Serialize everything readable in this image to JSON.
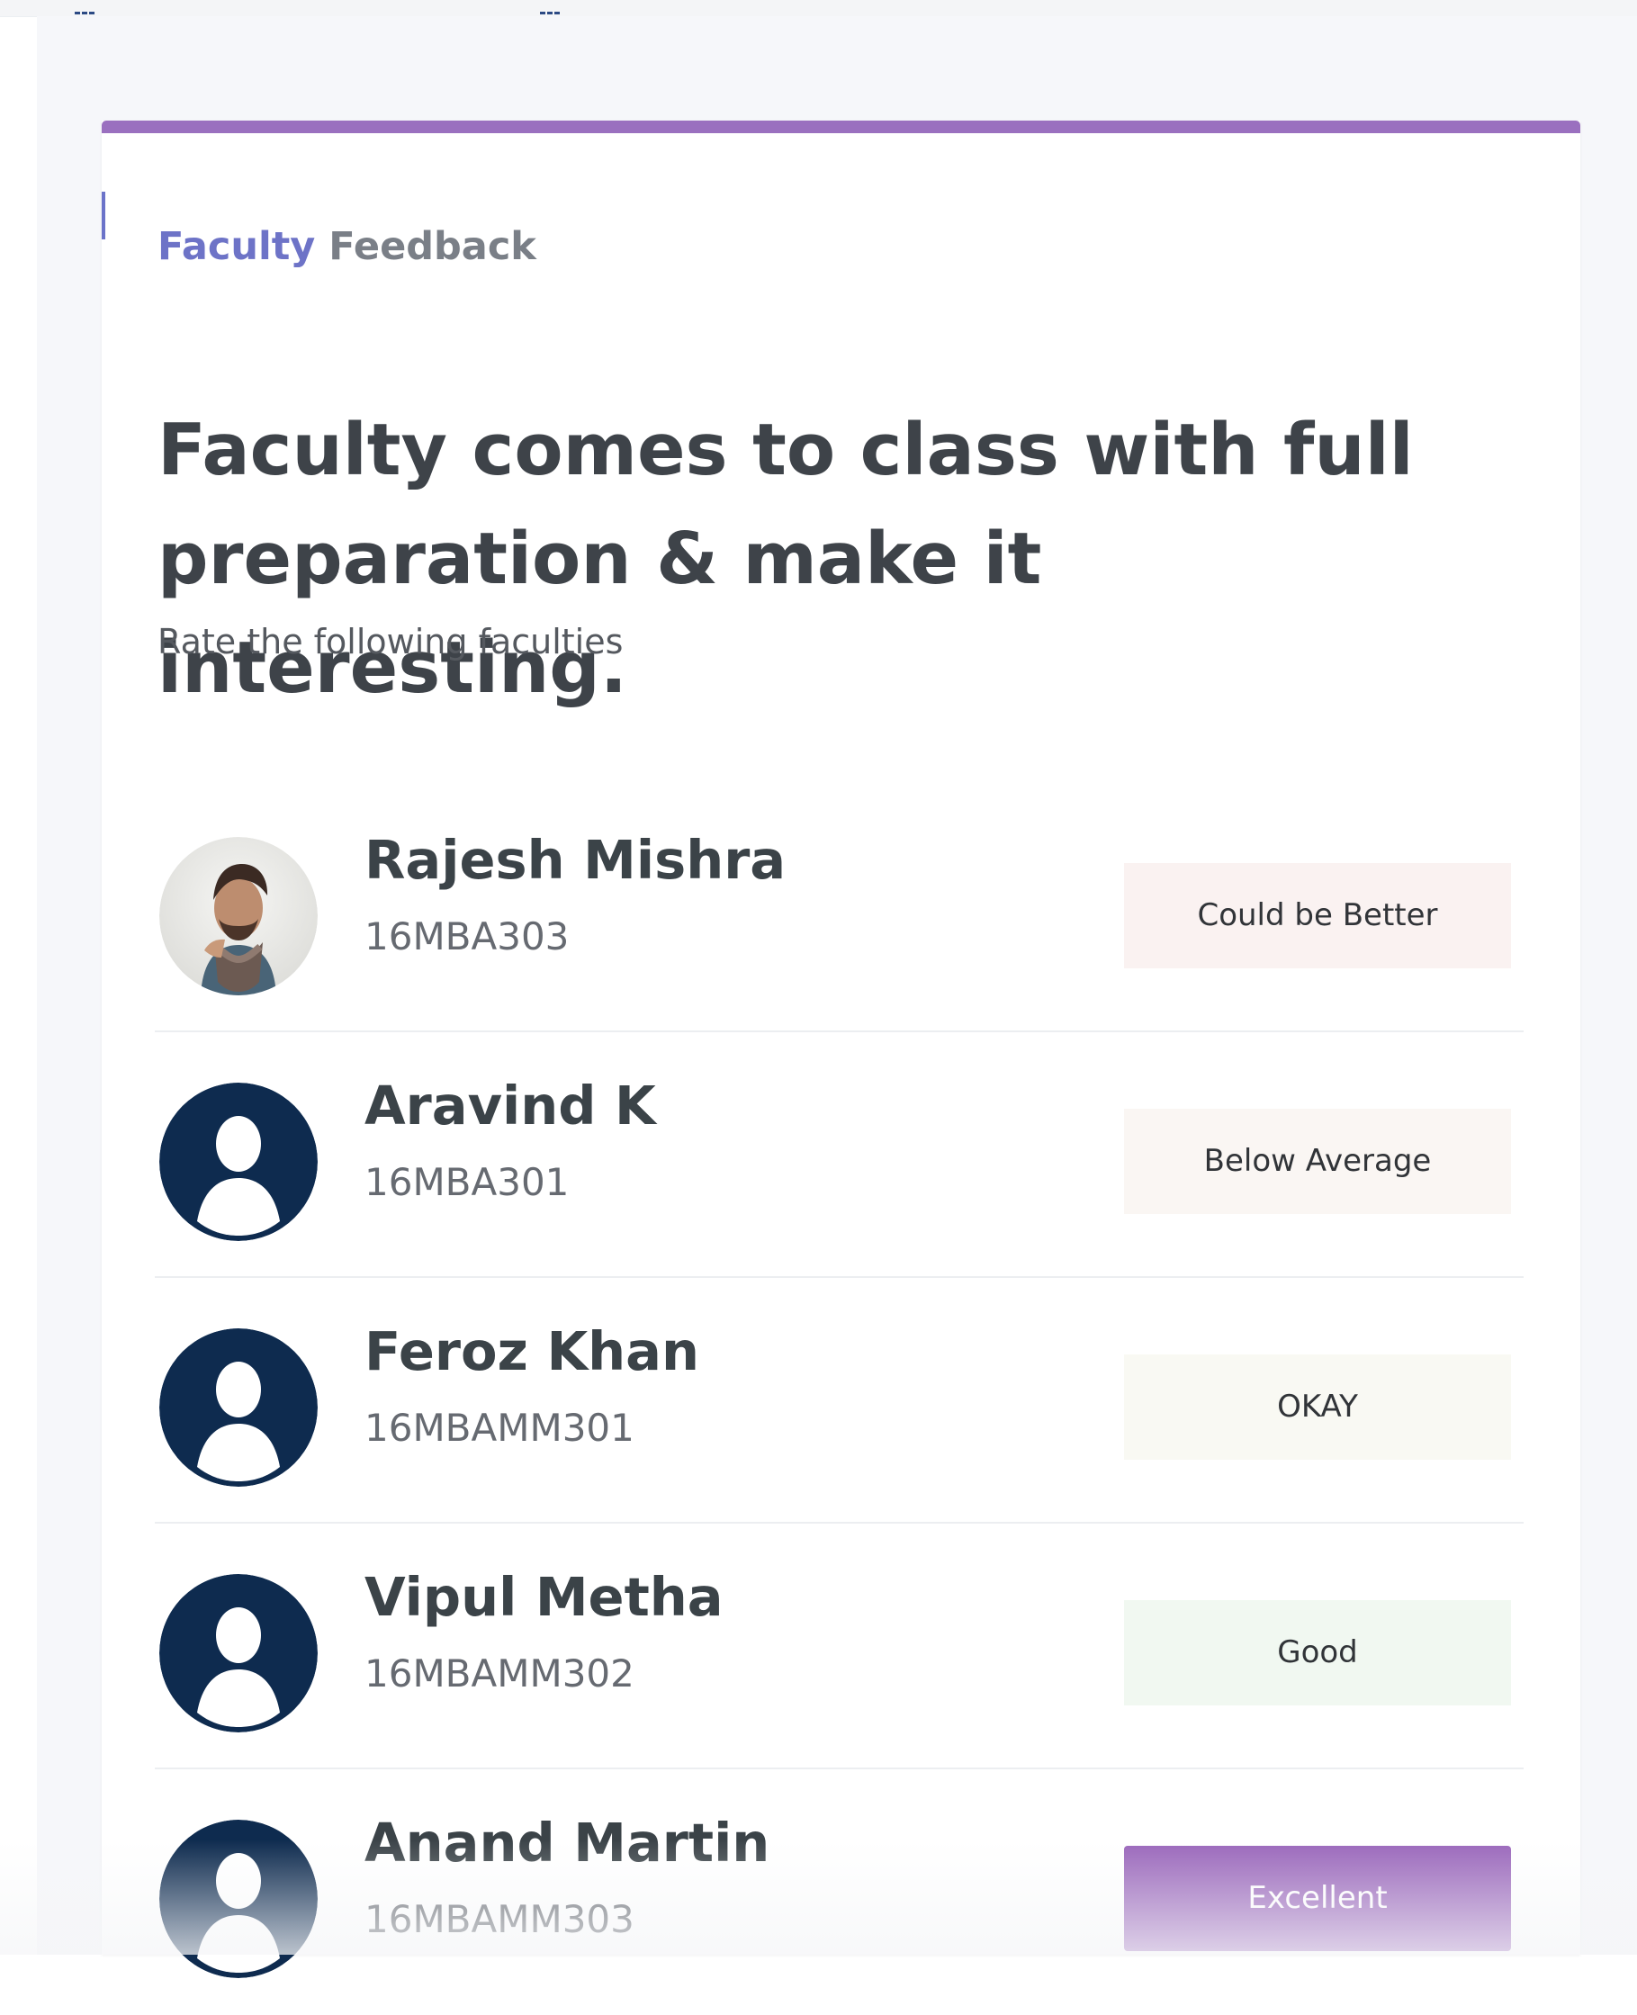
{
  "section": {
    "title_strong": "Faculty",
    "title_light": "Feedback"
  },
  "question": {
    "text": "Faculty comes to class with full preparation & make it interesting.",
    "subtitle": "Rate the following faculties"
  },
  "faculty": [
    {
      "name": "Rajesh Mishra",
      "code": "16MBA303",
      "rating": "Could be Better",
      "rating_color": "#faf2f1",
      "selected": false,
      "avatar": "photo-avatar-icon"
    },
    {
      "name": "Aravind K",
      "code": "16MBA301",
      "rating": "Below Average",
      "rating_color": "#faf6f3",
      "selected": false,
      "avatar": "user-avatar-icon"
    },
    {
      "name": "Feroz Khan",
      "code": "16MBAMM301",
      "rating": "OKAY",
      "rating_color": "#f9f9f3",
      "selected": false,
      "avatar": "user-avatar-icon"
    },
    {
      "name": "Vipul Metha",
      "code": "16MBAMM302",
      "rating": "Good",
      "rating_color": "#f1f8f1",
      "selected": false,
      "avatar": "user-avatar-icon"
    },
    {
      "name": "Anand Martin",
      "code": "16MBAMM303",
      "rating": "Excellent",
      "rating_color": "#9a67bb",
      "selected": true,
      "avatar": "user-avatar-icon"
    }
  ],
  "colors": {
    "accent": "#9a70bf",
    "section_title": "#6d73c7",
    "avatar_navy": "#0e2b4f"
  }
}
